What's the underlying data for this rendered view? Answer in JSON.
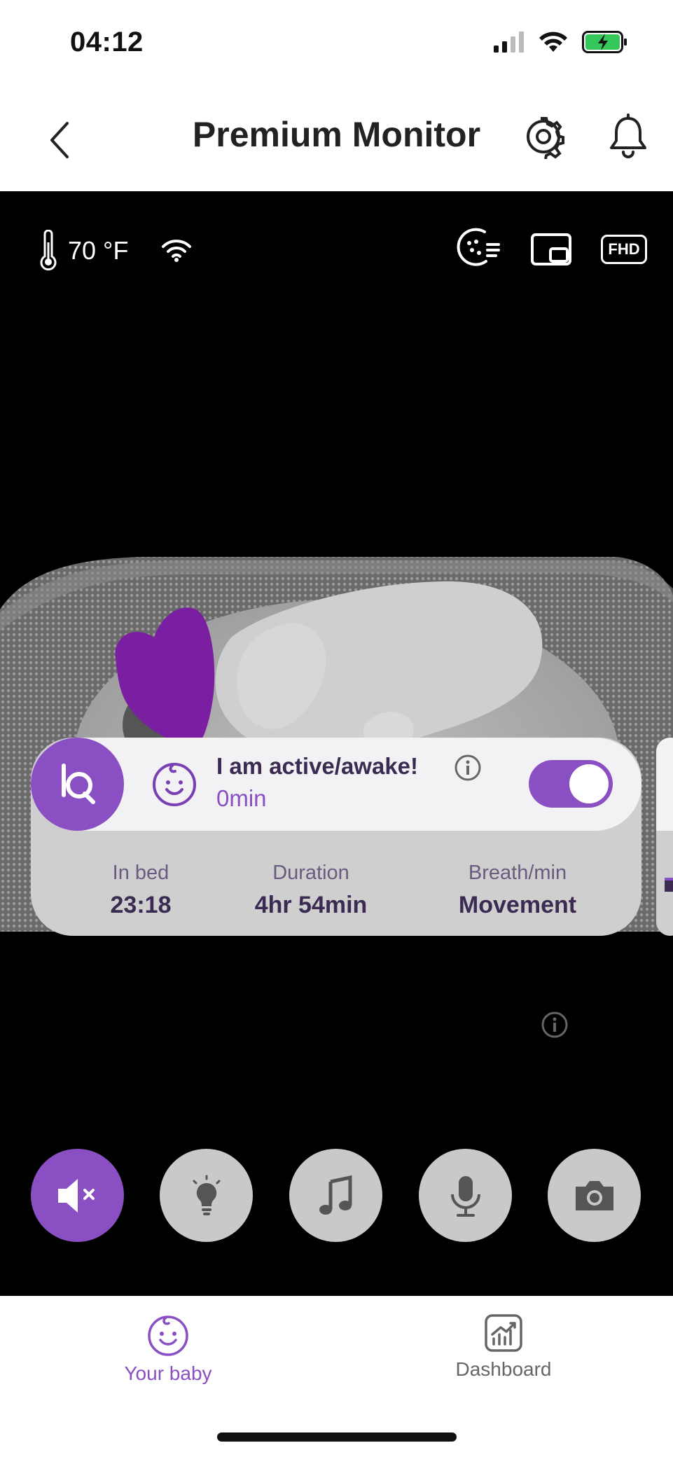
{
  "status_bar": {
    "time": "04:12"
  },
  "nav": {
    "title": "Premium Monitor"
  },
  "overlay": {
    "temperature": "70 °F",
    "quality_badge": "FHD"
  },
  "state_card": {
    "title": "I am active/awake!",
    "duration": "0min",
    "toggle_on": true
  },
  "stats": {
    "in_bed_label": "In bed",
    "in_bed_value": "23:18",
    "duration_label": "Duration",
    "duration_value": "4hr 54min",
    "breath_label": "Breath/min",
    "breath_value": "Movement"
  },
  "controls": [
    "mute-icon",
    "lightbulb-icon",
    "music-icon",
    "microphone-icon",
    "camera-icon"
  ],
  "tabs": {
    "baby_label": "Your baby",
    "dashboard_label": "Dashboard"
  },
  "colors": {
    "accent": "#8a4fc2",
    "card": "#cfcfcf",
    "card_top": "#f2f2f4",
    "dark_text": "#3b2a52"
  }
}
